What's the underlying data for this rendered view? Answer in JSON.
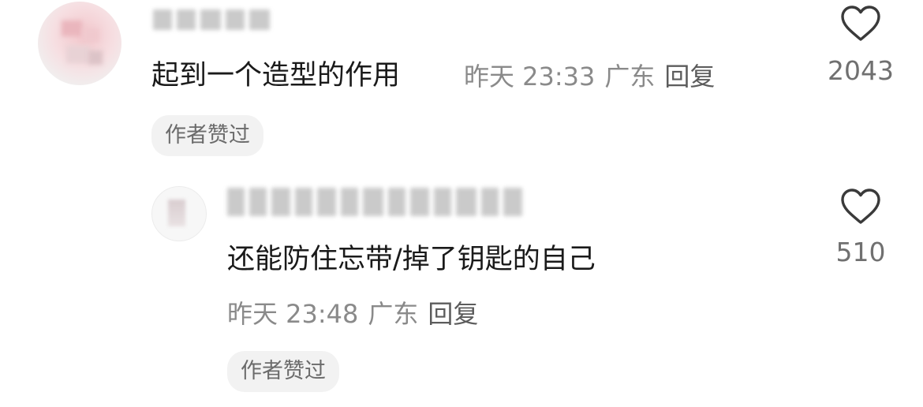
{
  "comment": {
    "text": "起到一个造型的作用",
    "time": "昨天 23:33",
    "location": "广东",
    "reply_label": "回复",
    "badge": "作者赞过",
    "likes": "2043",
    "like_icon": "heart-outline-icon"
  },
  "reply": {
    "text": "还能防住忘带/掉了钥匙的自己",
    "time": "昨天 23:48",
    "location": "广东",
    "reply_label": "回复",
    "badge": "作者赞过",
    "likes": "510",
    "like_icon": "heart-outline-icon"
  },
  "colors": {
    "text_primary": "#1a1a1a",
    "text_meta": "#8a8a8a",
    "badge_bg": "#f2f2f2"
  }
}
